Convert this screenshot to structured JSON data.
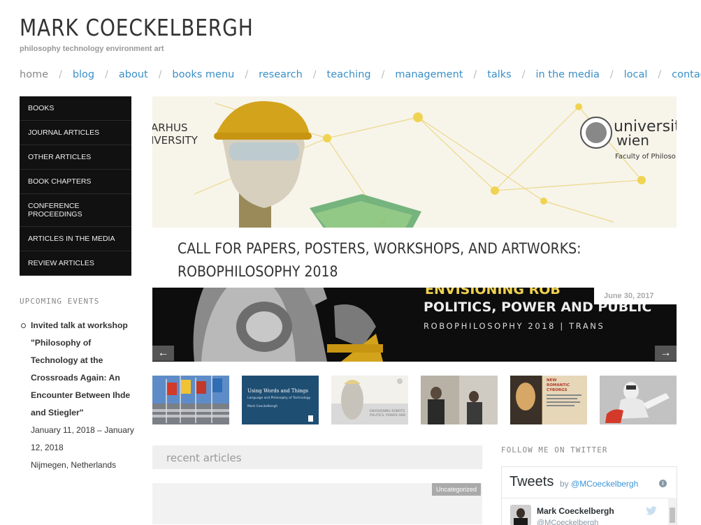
{
  "site": {
    "title": "MARK COECKELBERGH",
    "tagline": "philosophy technology environment art"
  },
  "nav": {
    "items": [
      "home",
      "blog",
      "about",
      "books menu",
      "research",
      "teaching",
      "management",
      "talks",
      "in the media",
      "local",
      "contact"
    ]
  },
  "sidebar": {
    "menu": [
      "BOOKS",
      "JOURNAL ARTICLES",
      "OTHER ARTICLES",
      "BOOK CHAPTERS",
      "CONFERENCE PROCEEDINGS",
      "ARTICLES IN THE MEDIA",
      "REVIEW ARTICLES"
    ],
    "events_heading": "UPCOMING EVENTS",
    "event": {
      "title": "Invited talk at workshop \"Philosophy of Technology at the Crossroads Again: An Encounter Between Ihde and Stiegler\"",
      "dates": "January 11, 2018 – January 12, 2018",
      "location": "Nijmegen, Netherlands"
    }
  },
  "slider": {
    "caption": "CALL FOR PAPERS, POSTERS, WORKSHOPS, AND ARTWORKS: ROBOPHILOSOPHY 2018",
    "date": "June 30, 2017",
    "prev": "←",
    "next": "→",
    "image_text": {
      "aarhus": "ARHUS\nIVERSITY",
      "wien_line1": "universit",
      "wien_line2": "wien",
      "wien_faculty": "Faculty of Philoso",
      "banner_top": "ENVISIONING ROB",
      "banner_mid": "POLITICS, POWER AND PUBLIC",
      "banner_bottom": "ROBOPHILOSOPHY 2018   |   TRANS"
    }
  },
  "thumbnails": {
    "book_title": "Using Words and Things",
    "book_subtitle": "Language and Philosophy of Technology",
    "book_author": "Mark Coeckelbergh",
    "book2_text": "NEW ROMANTIC CYBORGS"
  },
  "recent_articles": {
    "heading": "recent articles",
    "badge": "Uncategorized"
  },
  "twitter": {
    "heading": "FOLLOW ME ON TWITTER",
    "title": "Tweets",
    "by": "by",
    "handle_link": "@MCoeckelbergh",
    "name": "Mark Coeckelbergh",
    "handle": "@MCoeckelbergh",
    "info": "i"
  },
  "colors": {
    "link": "#3a8fc7",
    "menu_bg": "#111111",
    "accent_gold": "#e8c94a"
  }
}
